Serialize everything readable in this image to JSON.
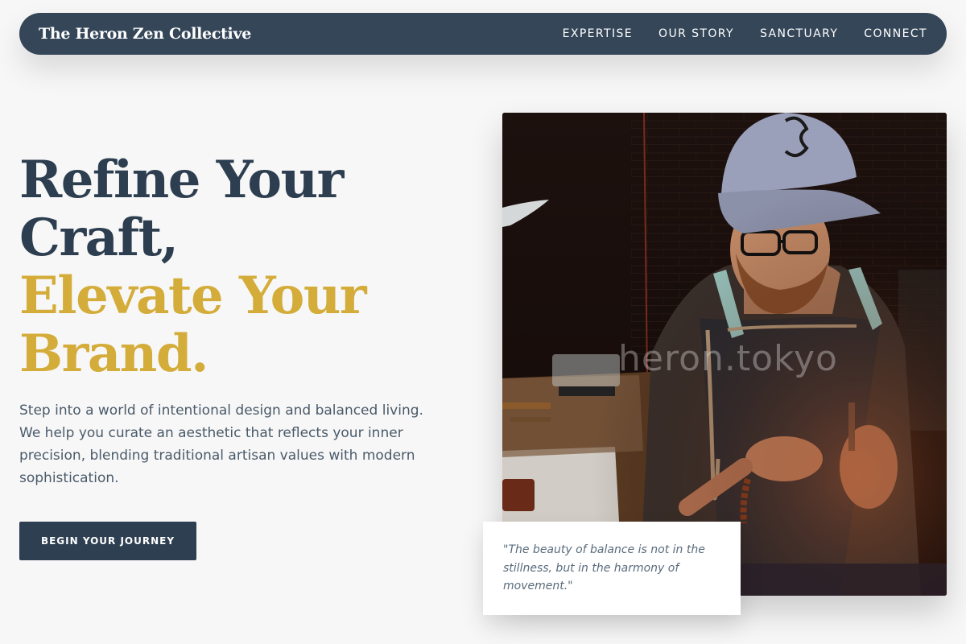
{
  "header": {
    "brand": "The Heron Zen Collective",
    "nav": [
      "EXPERTISE",
      "OUR STORY",
      "SANCTUARY",
      "CONNECT"
    ]
  },
  "hero": {
    "title_line1": "Refine Your",
    "title_line2": "Craft,",
    "title_line3": "Elevate Your",
    "title_line4": "Brand.",
    "description": "Step into a world of intentional design and balanced living. We help you curate an aesthetic that reflects your inner precision, blending traditional artisan values with modern sophistication.",
    "cta": "BEGIN YOUR JOURNEY"
  },
  "photo": {
    "watermark": "heron.tokyo"
  },
  "quote": {
    "text": "\"The beauty of balance is not in the stillness, but in the harmony of movement.\""
  },
  "colors": {
    "navy": "#344658",
    "title_dark": "#2c3e50",
    "accent_gold": "#d4ac3a",
    "background": "#f7f7f7"
  }
}
